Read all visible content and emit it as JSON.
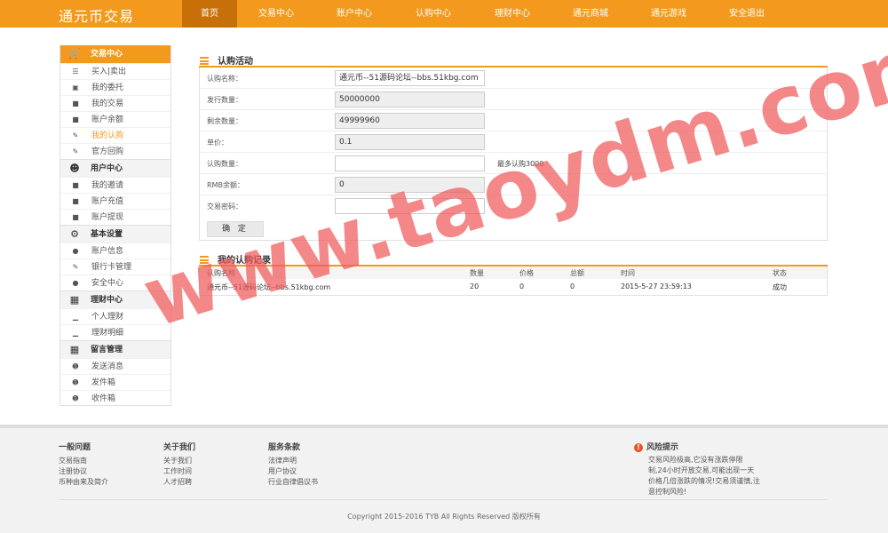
{
  "header": {
    "logo": "通元币交易",
    "nav": [
      "首页",
      "交易中心",
      "账户中心",
      "认购中心",
      "理财中心",
      "通元商城",
      "通元游戏",
      "安全退出"
    ]
  },
  "sidebar": {
    "groups": [
      {
        "title": "交易中心",
        "icon": "cart-icon",
        "items": [
          {
            "label": "买入|卖出",
            "icon": "list-icon"
          },
          {
            "label": "我的委托",
            "icon": "tray-icon"
          },
          {
            "label": "我的交易",
            "icon": "document-icon"
          },
          {
            "label": "账户余额",
            "icon": "document-icon"
          },
          {
            "label": "我的认购",
            "icon": "edit-icon"
          },
          {
            "label": "官方回购",
            "icon": "edit-icon"
          }
        ]
      },
      {
        "title": "用户中心",
        "icon": "users-icon",
        "items": [
          {
            "label": "我的邀请",
            "icon": "document-icon"
          },
          {
            "label": "账户充值",
            "icon": "document-icon"
          },
          {
            "label": "账户提现",
            "icon": "document-icon"
          }
        ]
      },
      {
        "title": "基本设置",
        "icon": "gear-icon",
        "items": [
          {
            "label": "账户信息",
            "icon": "user-icon"
          },
          {
            "label": "银行卡管理",
            "icon": "edit-icon"
          },
          {
            "label": "安全中心",
            "icon": "lock-icon"
          }
        ]
      },
      {
        "title": "理财中心",
        "icon": "document-icon",
        "items": [
          {
            "label": "个人理财",
            "icon": "bar-chart-icon"
          },
          {
            "label": "理财明细",
            "icon": "bar-chart-icon"
          }
        ]
      },
      {
        "title": "留言管理",
        "icon": "document-icon",
        "items": [
          {
            "label": "发送消息",
            "icon": "info-icon"
          },
          {
            "label": "发件箱",
            "icon": "info-icon"
          },
          {
            "label": "收件箱",
            "icon": "info-icon"
          }
        ]
      }
    ]
  },
  "subscribe": {
    "title": "认购活动",
    "fields": [
      {
        "label": "认购名称：",
        "value": "通元币--51源码论坛--bbs.51kbg.com",
        "readonly": false
      },
      {
        "label": "发行数量：",
        "value": "50000000",
        "readonly": true
      },
      {
        "label": "剩余数量：",
        "value": "49999960",
        "readonly": true
      },
      {
        "label": "单价：",
        "value": "0.1",
        "readonly": true
      },
      {
        "label": "认购数量：",
        "value": "",
        "readonly": false
      },
      {
        "label": "RMB余额：",
        "value": "0",
        "readonly": true
      },
      {
        "label": "交易密码：",
        "value": "",
        "readonly": false
      }
    ],
    "quantity_note": "最多认购3000",
    "confirm_label": "确 定"
  },
  "records": {
    "title": "我的认购记录",
    "columns": [
      "认购名称",
      "数量",
      "价格",
      "总额",
      "时间",
      "状态"
    ],
    "rows": [
      [
        "通元币--51源码论坛--bbs.51kbg.com",
        "20",
        "0",
        "0",
        "2015-5-27 23:59:13",
        "成功"
      ]
    ]
  },
  "watermark": "www.taoydm.com",
  "footer": {
    "columns": [
      {
        "title": "一般问题",
        "links": [
          "交易指南",
          "注册协议",
          "币种由来及简介"
        ]
      },
      {
        "title": "关于我们",
        "links": [
          "关于我们",
          "工作时间",
          "人才招聘"
        ]
      },
      {
        "title": "服务条款",
        "links": [
          "法律声明",
          "用户协议",
          "行业自律倡议书"
        ]
      }
    ],
    "risk_title": "风险提示",
    "risk_text": "交易风险极高,它没有涨跌停限制,24小时开放交易,可能出现一天价格几倍涨跌的情况!交易须谨慎,注意控制风险!",
    "copyright": "Copyright 2015-2016 TYB All Rights Reserved 版权所有"
  },
  "colors": {
    "accent": "#f39a1e",
    "nav_active": "#c7700a",
    "watermark": "#f05a5a"
  }
}
